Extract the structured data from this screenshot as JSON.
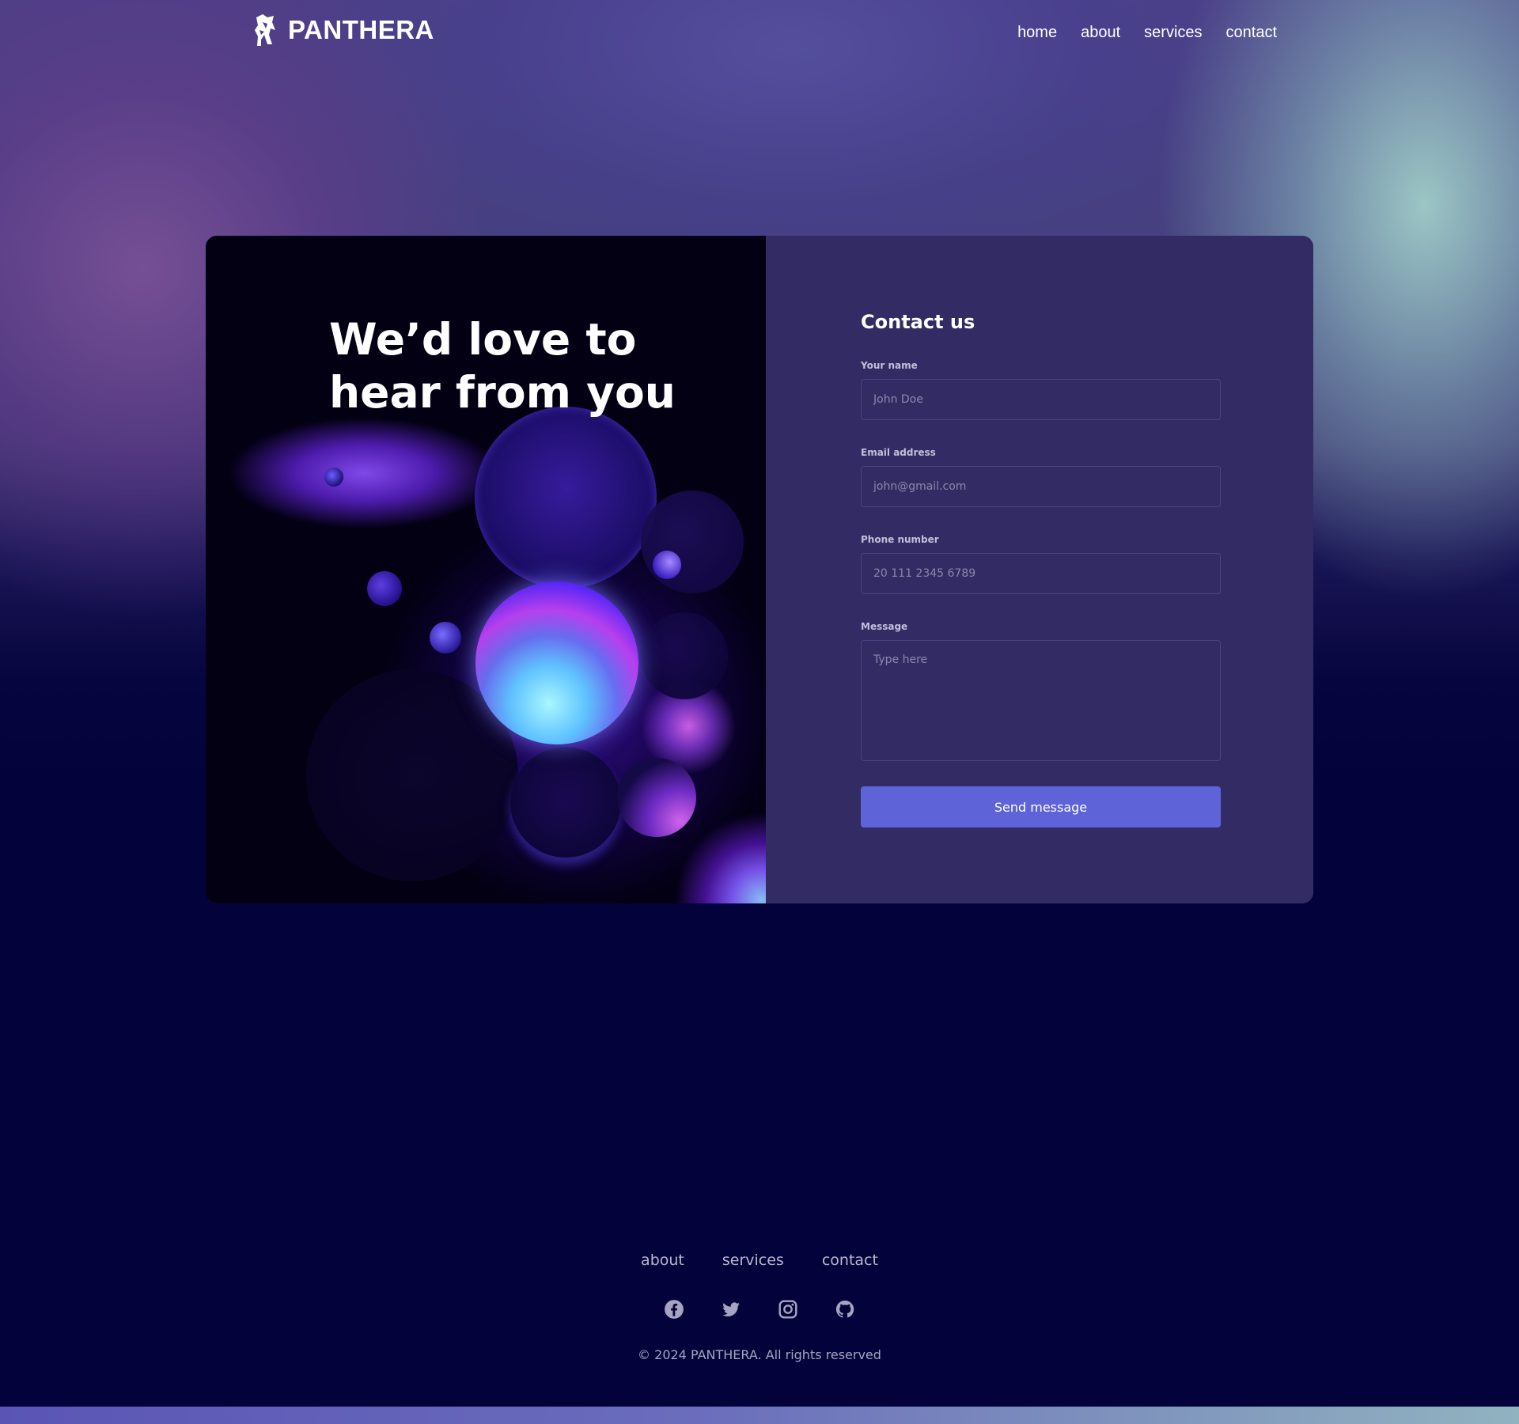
{
  "brand": {
    "name": "PANTHERA"
  },
  "nav": {
    "items": [
      {
        "label": "home"
      },
      {
        "label": "about"
      },
      {
        "label": "services"
      },
      {
        "label": "contact"
      }
    ]
  },
  "hero": {
    "title": "We’d love to hear from you"
  },
  "form": {
    "title": "Contact us",
    "name": {
      "label": "Your name",
      "placeholder": "John Doe"
    },
    "email": {
      "label": "Email address",
      "placeholder": "john@gmail.com"
    },
    "phone": {
      "label": "Phone number",
      "placeholder": "20 111 2345 6789"
    },
    "message": {
      "label": "Message",
      "placeholder": "Type here"
    },
    "submit_label": "Send message"
  },
  "footer": {
    "links": [
      {
        "label": "about"
      },
      {
        "label": "services"
      },
      {
        "label": "contact"
      }
    ],
    "social_icons": [
      "facebook-icon",
      "twitter-icon",
      "instagram-icon",
      "github-icon"
    ],
    "copyright": "© 2024 PANTHERA. All rights reserved"
  },
  "colors": {
    "card_background": "#332b64",
    "button": "#5e64d8",
    "page_bottom": "#03023a"
  }
}
